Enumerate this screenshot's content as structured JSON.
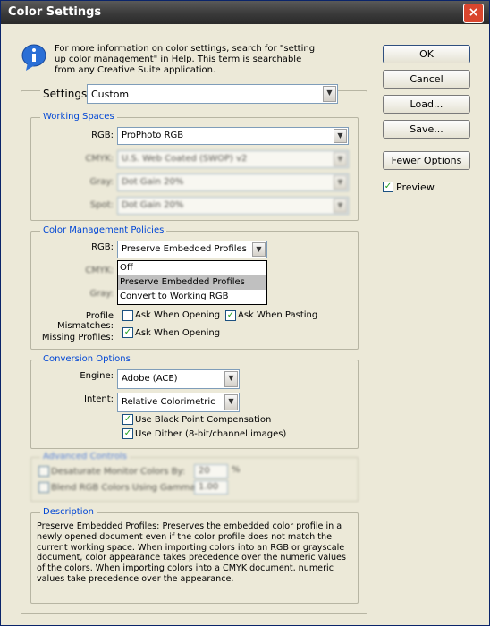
{
  "window": {
    "title": "Color Settings",
    "close_glyph": "×"
  },
  "info": {
    "icon": "info-icon",
    "text": "For more information on color settings, search for \"setting up color management\" in Help. This term is searchable from any Creative Suite application."
  },
  "settings": {
    "label": "Settings:",
    "value": "Custom"
  },
  "buttons": {
    "ok": "OK",
    "cancel": "Cancel",
    "load": "Load...",
    "save": "Save...",
    "fewer": "Fewer Options"
  },
  "preview": {
    "label": "Preview",
    "checked": true
  },
  "working_spaces": {
    "legend": "Working Spaces",
    "rgb_label": "RGB:",
    "rgb_value": "ProPhoto RGB",
    "cmyk_label": "CMYK:",
    "cmyk_value": "U.S. Web Coated (SWOP) v2",
    "gray_label": "Gray:",
    "gray_value": "Dot Gain 20%",
    "spot_label": "Spot:",
    "spot_value": "Dot Gain 20%"
  },
  "policies": {
    "legend": "Color Management Policies",
    "rgb_label": "RGB:",
    "rgb_value": "Preserve Embedded Profiles",
    "cmyk_label": "CMYK:",
    "gray_label": "Gray:",
    "options": [
      "Off",
      "Preserve Embedded Profiles",
      "Convert to Working RGB"
    ],
    "mismatch_label": "Profile Mismatches:",
    "ask_opening": "Ask When Opening",
    "ask_pasting": "Ask When Pasting",
    "missing_label": "Missing Profiles:",
    "missing_ask": "Ask When Opening"
  },
  "conversion": {
    "legend": "Conversion Options",
    "engine_label": "Engine:",
    "engine_value": "Adobe (ACE)",
    "intent_label": "Intent:",
    "intent_value": "Relative Colorimetric",
    "bpc": "Use Black Point Compensation",
    "dither": "Use Dither (8-bit/channel images)"
  },
  "advanced": {
    "legend": "Advanced Controls",
    "desaturate": "Desaturate Monitor Colors By:",
    "desaturate_value": "20",
    "percent": "%",
    "blend": "Blend RGB Colors Using Gamma:",
    "blend_value": "1.00"
  },
  "description": {
    "legend": "Description",
    "text": "Preserve Embedded Profiles:  Preserves the embedded color profile in a newly opened document even if the color profile does not match the current working space.  When importing colors into an RGB or grayscale document, color appearance takes precedence over the numeric values of the colors. When importing colors into a CMYK document, numeric values take precedence over the appearance."
  },
  "glyphs": {
    "check": "✓",
    "chevron": "▼"
  }
}
